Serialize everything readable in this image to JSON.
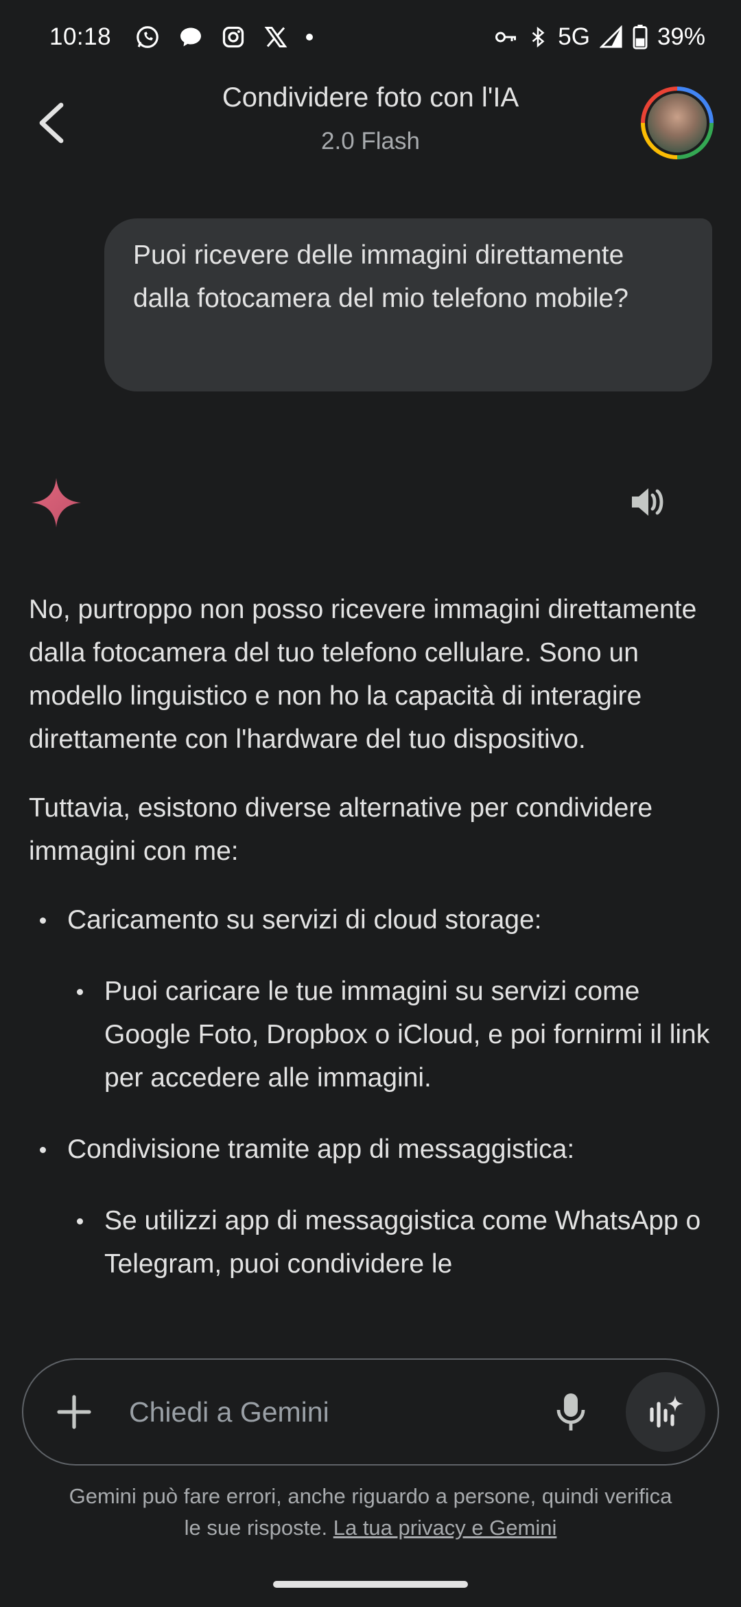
{
  "status_bar": {
    "time": "10:18",
    "network": "5G",
    "battery": "39%",
    "icons": [
      "whatsapp-icon",
      "chat-icon",
      "instagram-icon",
      "x-icon",
      "dot-icon",
      "vpn-key-icon",
      "bluetooth-icon",
      "signal-icon",
      "battery-icon"
    ]
  },
  "header": {
    "title": "Condividere foto con l'IA",
    "subtitle": "2.0 Flash"
  },
  "user_message": "Puoi ricevere delle immagini direttamente dalla fotocamera del mio telefono mobile?",
  "response": {
    "p1": "No, purtroppo non posso ricevere immagini direttamente dalla fotocamera del tuo telefono cellulare. Sono un modello linguistico e non ho la capacità di interagire direttamente con l'hardware del tuo dispositivo.",
    "p2": "Tuttavia, esistono diverse alternative per condividere immagini con me:",
    "bullet1": "Caricamento su servizi di cloud storage:",
    "bullet1_sub": "Puoi caricare le tue immagini su servizi come Google Foto, Dropbox o iCloud, e poi fornirmi il link per accedere alle immagini.",
    "bullet2": "Condivisione tramite app di messaggistica:",
    "bullet2_sub": "Se utilizzi app di messaggistica come WhatsApp o Telegram, puoi condividere le"
  },
  "input": {
    "placeholder": "Chiedi a Gemini"
  },
  "disclaimer": {
    "text": "Gemini può fare errori, anche riguardo a persone, quindi verifica le sue risposte. ",
    "link": "La tua privacy e Gemini"
  },
  "colors": {
    "background": "#1b1c1d",
    "bubble": "#333537",
    "text": "#e3e3e3",
    "muted": "#a8abae",
    "gemini_star": "#d9647a"
  }
}
